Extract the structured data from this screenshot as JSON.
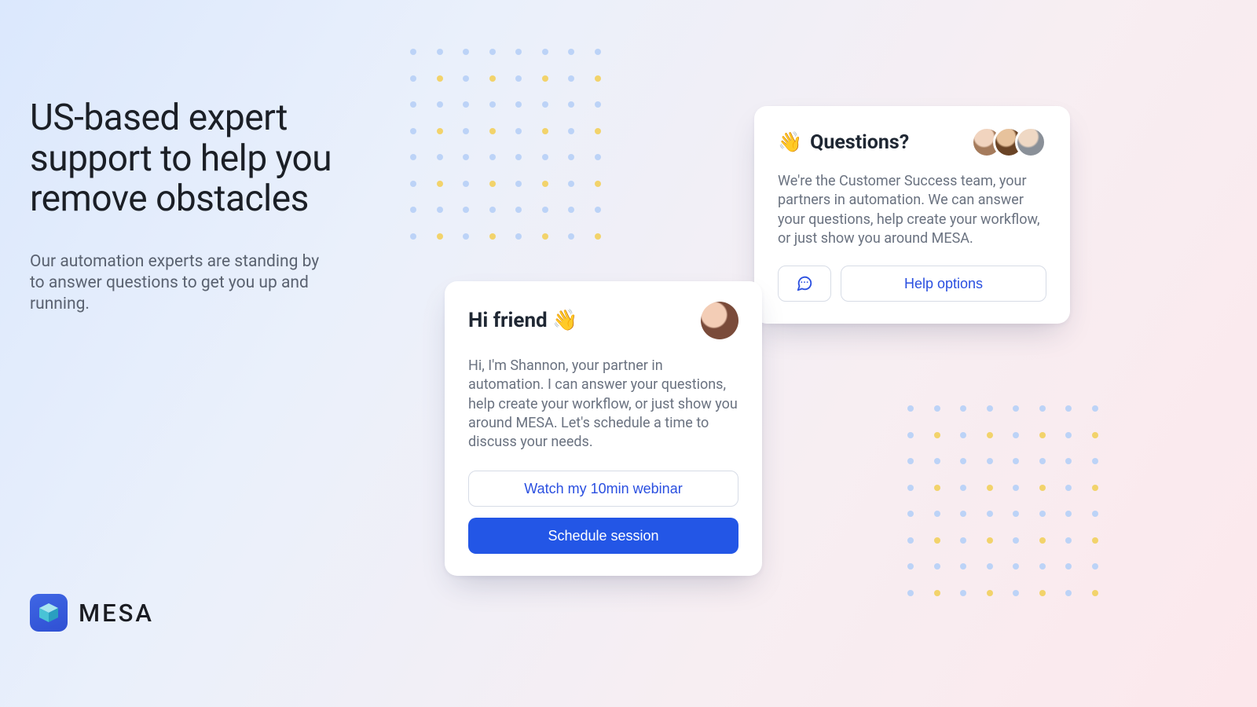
{
  "hero": {
    "headline": "US-based expert support to help you remove obstacles",
    "subhead": "Our automation experts are standing by to answer questions to get you up and running."
  },
  "brand": {
    "name": "MESA"
  },
  "cards": {
    "questions": {
      "emoji": "👋",
      "title": "Questions?",
      "body": "We're the Customer Success team, your partners in automation. We can answer your questions, help create your workflow, or just show you around MESA.",
      "help_label": "Help options"
    },
    "friend": {
      "title": "Hi friend 👋",
      "body": "Hi, I'm Shannon, your partner in automation. I can answer your questions, help create your workflow, or just show you around MESA. Let's schedule a time to discuss your needs.",
      "watch_label": "Watch my 10min webinar",
      "schedule_label": "Schedule session"
    }
  }
}
